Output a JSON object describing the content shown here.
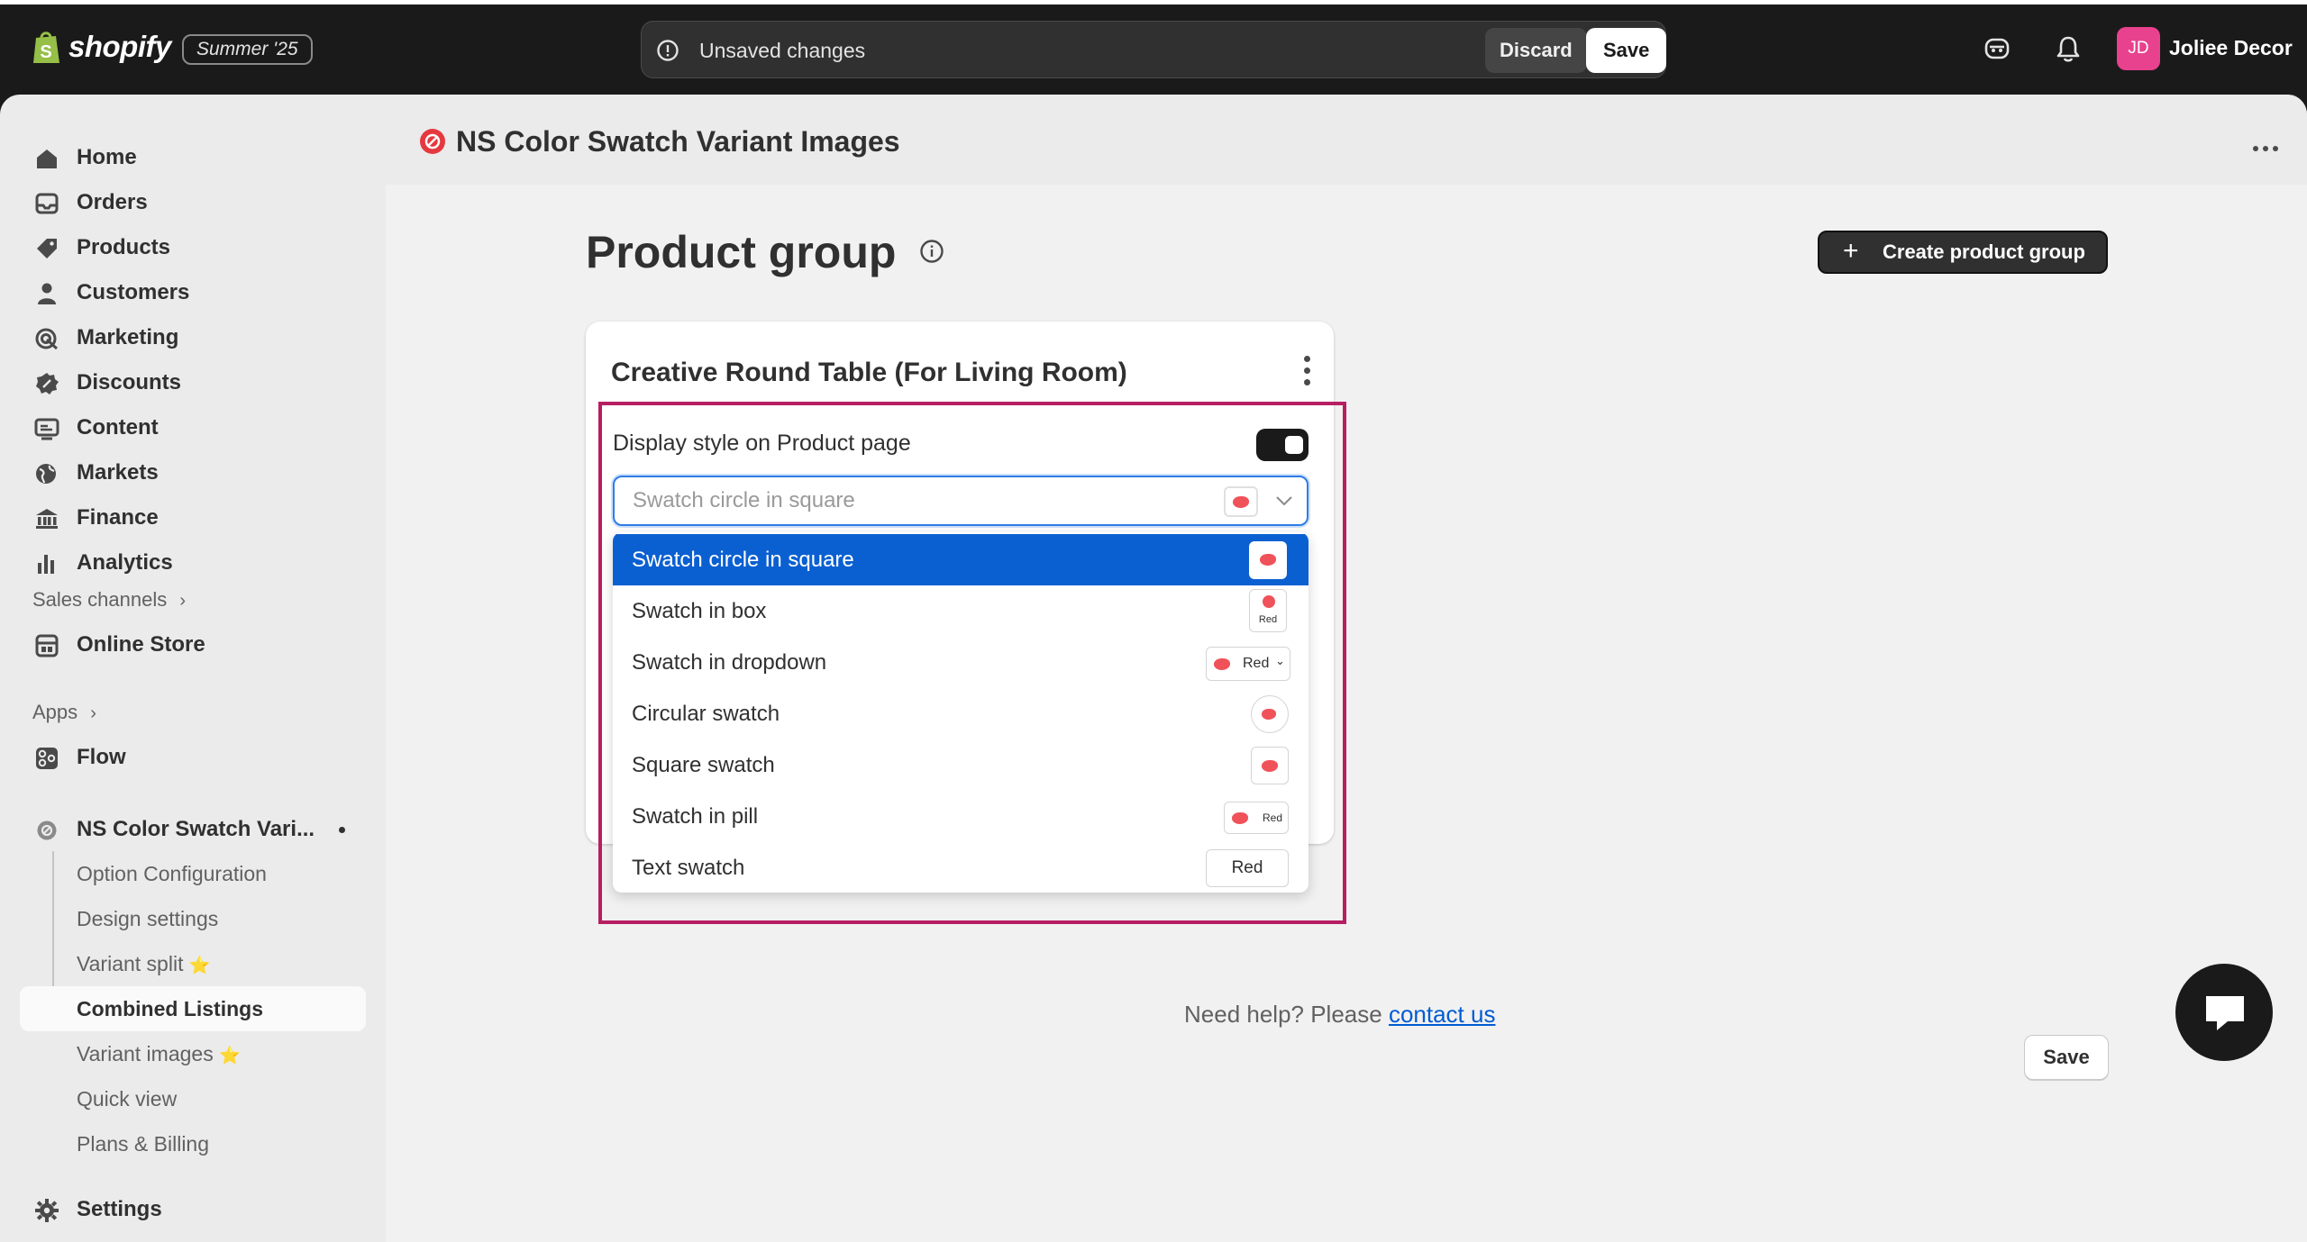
{
  "topbar": {
    "logo_text": "shopify",
    "season_badge": "Summer '25",
    "unsaved_text": "Unsaved changes",
    "discard_label": "Discard",
    "save_label": "Save",
    "avatar_initials": "JD",
    "avatar_color": "#e8418e",
    "store_name": "Joliee Decor"
  },
  "sidebar": {
    "items": [
      {
        "label": "Home",
        "icon": "home-icon"
      },
      {
        "label": "Orders",
        "icon": "inbox-icon"
      },
      {
        "label": "Products",
        "icon": "tag-icon"
      },
      {
        "label": "Customers",
        "icon": "person-icon"
      },
      {
        "label": "Marketing",
        "icon": "target-icon"
      },
      {
        "label": "Discounts",
        "icon": "discount-icon"
      },
      {
        "label": "Content",
        "icon": "content-icon"
      },
      {
        "label": "Markets",
        "icon": "globe-icon"
      },
      {
        "label": "Finance",
        "icon": "bank-icon"
      },
      {
        "label": "Analytics",
        "icon": "bar-chart-icon"
      }
    ],
    "sales_channels_title": "Sales channels",
    "online_store": "Online Store",
    "apps_title": "Apps",
    "flow": "Flow",
    "app_name": "NS Color Swatch Vari...",
    "app_sub_items": [
      {
        "label": "Option Configuration",
        "star": ""
      },
      {
        "label": "Design settings",
        "star": ""
      },
      {
        "label": "Variant split",
        "star": "⭐"
      },
      {
        "label": "Combined Listings",
        "star": ""
      },
      {
        "label": "Variant images",
        "star": "⭐"
      },
      {
        "label": "Quick view",
        "star": ""
      },
      {
        "label": "Plans & Billing",
        "star": ""
      }
    ],
    "settings": "Settings"
  },
  "main": {
    "app_title": "NS Color Swatch Variant Images",
    "page_title": "Product group",
    "create_button": "Create product group",
    "card_title": "Creative Round Table (For Living Room)",
    "setting_label": "Display style on Product page",
    "toggle_on": true,
    "select_placeholder": "Swatch circle in square",
    "options": [
      {
        "label": "Swatch circle in square"
      },
      {
        "label": "Swatch in box",
        "preview_text": "Red"
      },
      {
        "label": "Swatch in dropdown",
        "preview_text": "Red"
      },
      {
        "label": "Circular swatch"
      },
      {
        "label": "Square swatch"
      },
      {
        "label": "Swatch in pill",
        "preview_text": "Red"
      },
      {
        "label": "Text swatch",
        "preview_text": "Red"
      }
    ],
    "selected_option_index": 0,
    "help_prefix": "Need help? Please ",
    "help_link": "contact us",
    "save_label": "Save"
  },
  "colors": {
    "accent_blue": "#0b60d1",
    "highlight_border": "#b71e62",
    "swatch_red": "#f0525a"
  }
}
